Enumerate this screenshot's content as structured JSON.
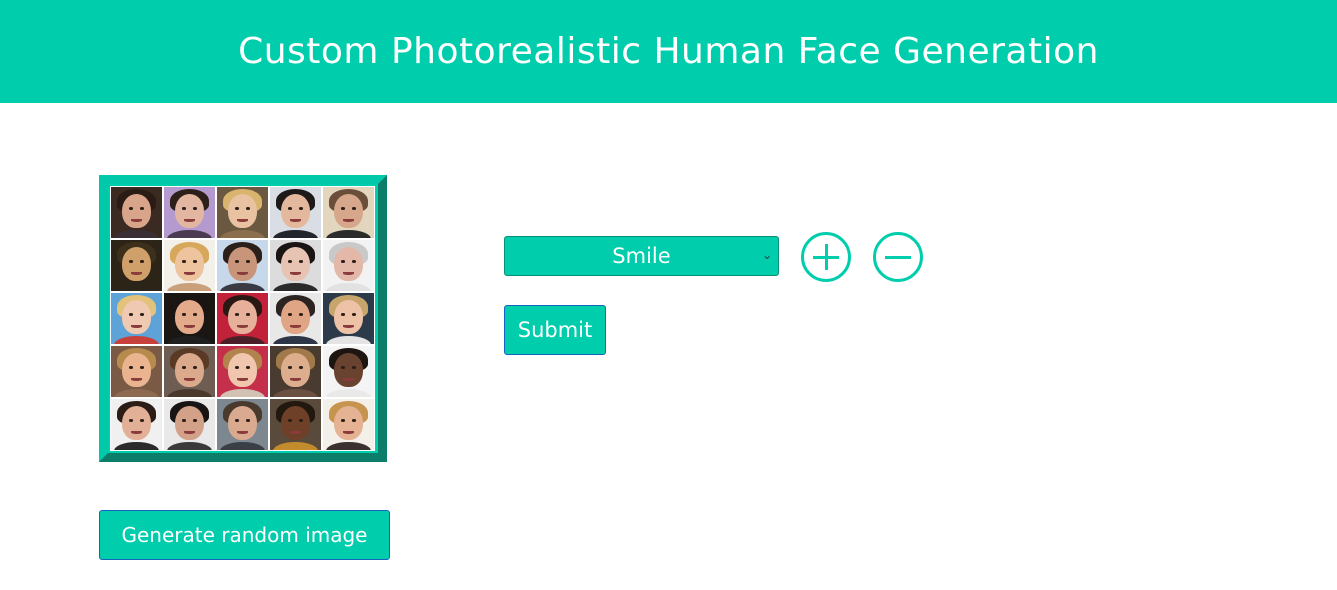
{
  "header": {
    "title": "Custom Photorealistic Human Face Generation"
  },
  "image_grid": {
    "cells": [
      {
        "bg": "#3b2a22",
        "skin": "#d9a58a",
        "hair": "#2a1b14",
        "top": "#3a2f35"
      },
      {
        "bg": "#b59ad0",
        "skin": "#e2b6a0",
        "hair": "#2d1f1a",
        "top": "#4a3b52"
      },
      {
        "bg": "#6b5840",
        "skin": "#e9c2a2",
        "hair": "#d9b46e",
        "top": "#8a6e4d"
      },
      {
        "bg": "#d9dde4",
        "skin": "#e4b89d",
        "hair": "#1d1a19",
        "top": "#22252b"
      },
      {
        "bg": "#e2d6bf",
        "skin": "#d7a78b",
        "hair": "#6a4e3a",
        "top": "#2b2b2b"
      },
      {
        "bg": "#2c2417",
        "skin": "#cfa06a",
        "hair": "#3c2f1c",
        "top": "#2b2418"
      },
      {
        "bg": "#f3efe9",
        "skin": "#edc49d",
        "hair": "#d7a85c",
        "top": "#caa07a"
      },
      {
        "bg": "#c7d8ea",
        "skin": "#c9957a",
        "hair": "#2b2019",
        "top": "#3a3a44"
      },
      {
        "bg": "#dcdcdc",
        "skin": "#e7c3b3",
        "hair": "#1a1414",
        "top": "#2a2a2a"
      },
      {
        "bg": "#f2f2f2",
        "skin": "#e3b8a8",
        "hair": "#c9c9c9",
        "top": "#e2e2e2"
      },
      {
        "bg": "#5ea3d8",
        "skin": "#f0c9b2",
        "hair": "#e3c27c",
        "top": "#c8403b"
      },
      {
        "bg": "#1a1614",
        "skin": "#e3ab8a",
        "hair": "#1a1412",
        "top": "#1f1f1f"
      },
      {
        "bg": "#c2213a",
        "skin": "#e6b09a",
        "hair": "#2a1814",
        "top": "#4a2028"
      },
      {
        "bg": "#e8e8e8",
        "skin": "#e0a585",
        "hair": "#2c2420",
        "top": "#2c3646"
      },
      {
        "bg": "#2c3a4a",
        "skin": "#edc2a6",
        "hair": "#c6a66a",
        "top": "#e4e4e4"
      },
      {
        "bg": "#7a5a44",
        "skin": "#e9b48f",
        "hair": "#b78a4e",
        "top": "#8e6a50"
      },
      {
        "bg": "#6e5d52",
        "skin": "#dba98c",
        "hair": "#5a3a25",
        "top": "#4a3a2e"
      },
      {
        "bg": "#c4304a",
        "skin": "#f0c7ae",
        "hair": "#b2834c",
        "top": "#d2c2b4"
      },
      {
        "bg": "#4a3b30",
        "skin": "#dcae8e",
        "hair": "#a27a4a",
        "top": "#6a5040"
      },
      {
        "bg": "#f4f4f4",
        "skin": "#6a4330",
        "hair": "#1c1512",
        "top": "#e9e9e9"
      },
      {
        "bg": "#f0f0f0",
        "skin": "#e1b096",
        "hair": "#2b1d16",
        "top": "#2a2a2a"
      },
      {
        "bg": "#e9e9e9",
        "skin": "#d2a188",
        "hair": "#181414",
        "top": "#3a3a3a"
      },
      {
        "bg": "#7d8790",
        "skin": "#d9a990",
        "hair": "#4a3a2e",
        "top": "#3a3f46"
      },
      {
        "bg": "#5a4a3c",
        "skin": "#6e4028",
        "hair": "#22180f",
        "top": "#c28b2b"
      },
      {
        "bg": "#f3f0ea",
        "skin": "#e5b394",
        "hair": "#c79450",
        "top": "#3a3030"
      }
    ]
  },
  "controls": {
    "attribute_select": {
      "selected": "Smile"
    },
    "plus_icon": "plus-circle-icon",
    "minus_icon": "minus-circle-icon",
    "submit_label": "Submit",
    "generate_label": "Generate random image"
  },
  "colors": {
    "accent": "#00cdac",
    "button_border": "#1565c0"
  }
}
